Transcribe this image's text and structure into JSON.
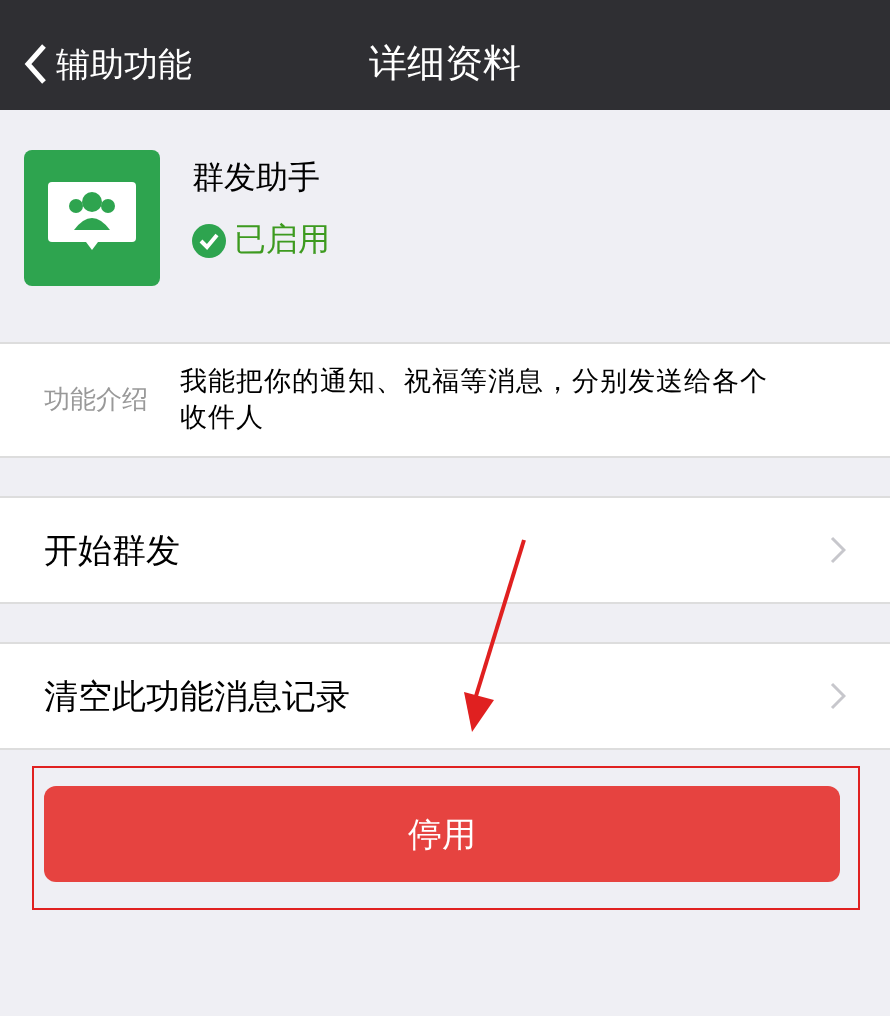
{
  "nav": {
    "back": "辅助功能",
    "title": "详细资料"
  },
  "profile": {
    "name": "群发助手",
    "status": "已启用",
    "enabled": true
  },
  "intro": {
    "label": "功能介绍",
    "text": "我能把你的通知、祝福等消息，分别发送给各个收件人"
  },
  "rows": [
    {
      "label": "开始群发"
    },
    {
      "label": "清空此功能消息记录"
    }
  ],
  "button": {
    "label": "停用"
  }
}
